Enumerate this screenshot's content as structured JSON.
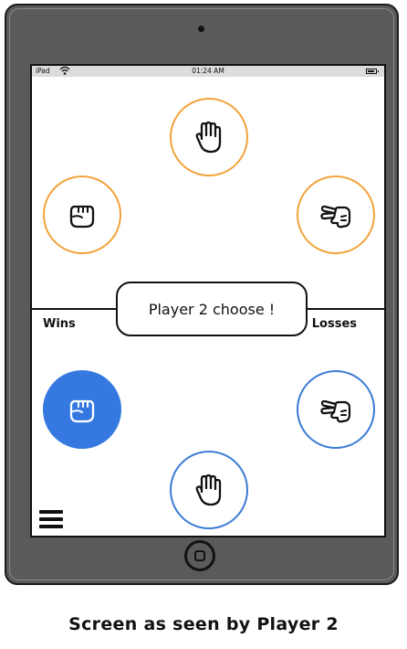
{
  "status_bar": {
    "carrier": "iPad",
    "time": "01:24 AM"
  },
  "icons": {
    "wifi": "wifi-icon",
    "battery": "battery-icon",
    "paper_hand": "open-hand-icon",
    "rock_hand": "fist-icon",
    "scissors_hand": "scissors-hand-icon",
    "menu": "hamburger-menu-icon"
  },
  "colors": {
    "opponent_choice_border": "#f2a23a",
    "player_choice_border": "#3a7bd5",
    "selected_fill": "#3478e0"
  },
  "opponent_choices": [
    "paper",
    "rock",
    "scissors"
  ],
  "player_choices": [
    "rock",
    "scissors",
    "paper"
  ],
  "selected_choice": "rock",
  "scoreboard": {
    "wins_label": "Wins",
    "losses_label": "Losses"
  },
  "prompt": {
    "text": "Player 2 choose !"
  },
  "caption": "Screen as seen by Player 2"
}
